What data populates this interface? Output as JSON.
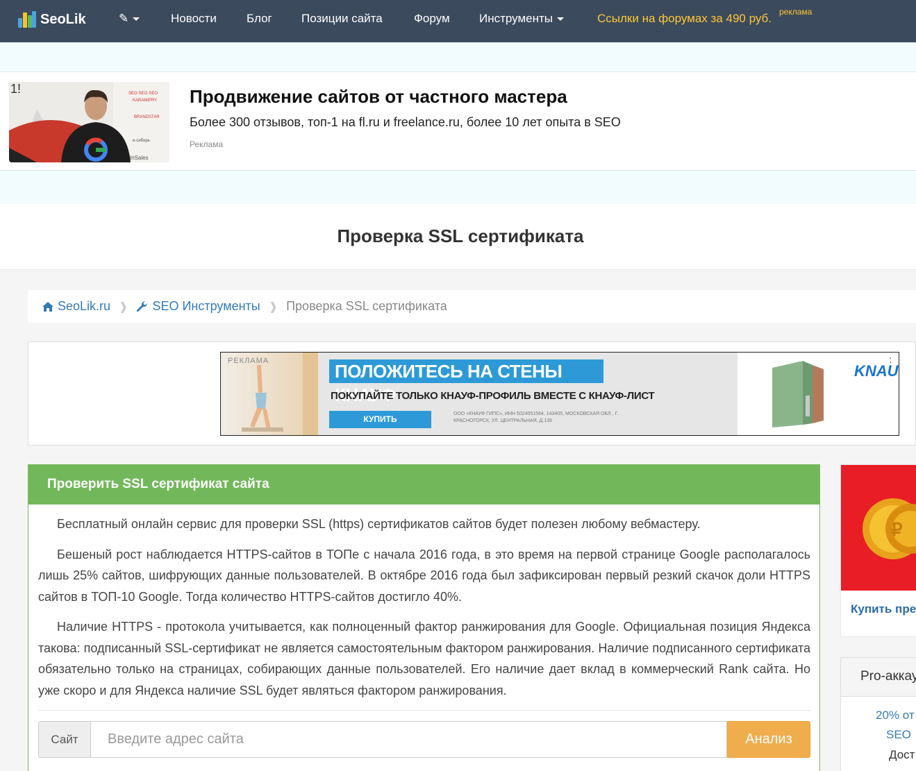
{
  "nav": {
    "logo_text": "SeoLik",
    "items": [
      {
        "label": "Новости"
      },
      {
        "label": "Блог"
      },
      {
        "label": "Позиции сайта"
      },
      {
        "label": "Форум"
      },
      {
        "label": "Инструменты"
      }
    ],
    "ad_link": "Ссылки на форумах за 490 руб.",
    "ad_tag": "реклама"
  },
  "promo": {
    "title": "Продвижение сайтов от частного мастера",
    "subtitle": "Более 300 отзывов, топ-1 на fl.ru и freelance.ru, более 10 лет опыта в SEO",
    "tag": "Реклама"
  },
  "page": {
    "title": "Проверка SSL сертификата"
  },
  "breadcrumb": {
    "home": "SeoLik.ru",
    "tools": "SEO Инструменты",
    "current": "Проверка SSL сертификата",
    "separator": "❱"
  },
  "ad_banner": {
    "label": "РЕКЛАМА",
    "headline": "ПОЛОЖИТЕСЬ НА СТЕНЫ КНАУФ",
    "line": "ПОКУПАЙТЕ ТОЛЬКО КНАУФ-ПРОФИЛЬ ВМЕСТЕ С КНАУФ-ЛИСТ",
    "button": "КУПИТЬ",
    "legal": "ООО «КНАУФ ГИПС», ИНН 5024051564, 143405, МОСКОВСКАЯ ОБЛ., Г. КРАСНОГОРСК, УЛ. ЦЕНТРАЛЬНАЯ, Д.139",
    "brand": "KNAUF"
  },
  "panel": {
    "title": "Проверить SSL сертификат сайта",
    "paragraphs": [
      "Бесплатный онлайн сервис для проверки SSL (https) сертификатов сайтов будет полезен любому вебмастеру.",
      "Бешеный рост наблюдается HTTPS-сайтов в ТОПе с начала 2016 года, в это время на первой странице Google располагалось лишь 25% сайтов, шифрующих данные пользователей. В октябре 2016 года был зафиксирован первый резкий скачок доли HTTPS сайтов в ТОП-10 Google. Тогда количество HTTPS-сайтов достигло 40%.",
      "Наличие HTTPS - протокола учитывается, как полноценный фактор ранжирования для Google. Официальная позиция Яндекса такова: подписанный SSL-сертификат не является самостоятельным фактором ранжирования. Наличие подписанного сертификата обязательно только на страницах, собирающих данные пользователей. Его наличие дает вклад в коммерческий Rank сайта. Но уже скоро и для Яндекса наличие SSL будет являться фактором ранжирования."
    ],
    "input_addon": "Сайт",
    "input_placeholder": "Введите адрес сайта",
    "input_value": "",
    "button": "Анализ"
  },
  "sidebar": {
    "buy_link": "Купить пре",
    "pro_title": "Pro-аккау",
    "pro_line1": "20% от",
    "pro_line2": "SEO",
    "pro_line3": "Дост"
  },
  "colors": {
    "nav_bg": "#3b4a5d",
    "ad_link": "#ffc733",
    "panel_header": "#72b85a",
    "link": "#337ab7",
    "button": "#f0ad4e"
  }
}
